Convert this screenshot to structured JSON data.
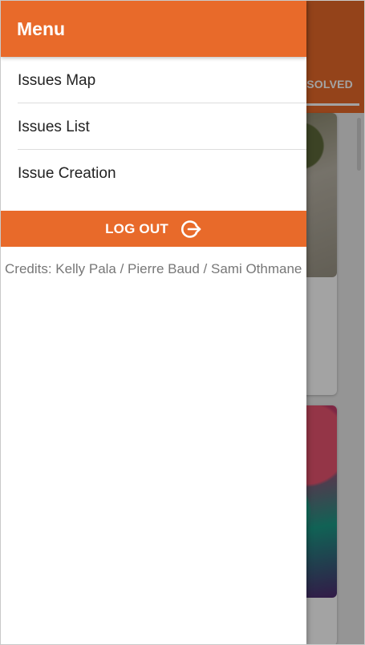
{
  "background": {
    "tab_label": "RESOLVED"
  },
  "drawer": {
    "title": "Menu",
    "items": [
      {
        "label": "Issues Map"
      },
      {
        "label": "Issues List"
      },
      {
        "label": "Issue Creation"
      }
    ],
    "logout_label": "LOG OUT",
    "logout_icon": "logout-icon",
    "credits": "Credits: Kelly Pala / Pierre Baud / Sami Othmane"
  },
  "colors": {
    "accent": "#e86a2a",
    "text_primary": "#222222",
    "text_muted": "#777777"
  }
}
